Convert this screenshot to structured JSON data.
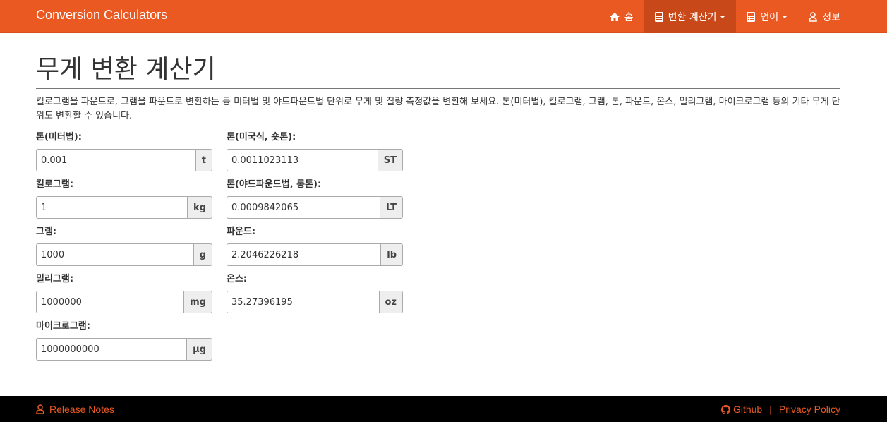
{
  "navbar": {
    "brand": "Conversion Calculators",
    "items": [
      {
        "label": "홈",
        "icon": "home-icon"
      },
      {
        "label": "변환 계산기",
        "icon": "calculator-icon",
        "active": true,
        "dropdown": true
      },
      {
        "label": "언어",
        "icon": "calculator-icon",
        "dropdown": true
      },
      {
        "label": "정보",
        "icon": "user-icon"
      }
    ]
  },
  "page": {
    "title": "무게 변환 계산기",
    "description": "킬로그램을 파운드로, 그램을 파운드로 변환하는 등 미터법 및 야드파운드법 단위로 무게 및 질량 측정값을 변환해 보세요. 톤(미터법), 킬로그램, 그램, 톤, 파운드, 온스, 밀리그램, 마이크로그램 등의 기타 무게 단위도 변환할 수 있습니다."
  },
  "fields": {
    "tonne": {
      "label": "톤(미터법):",
      "value": "0.001",
      "unit": "t"
    },
    "kilogram": {
      "label": "킬로그램:",
      "value": "1",
      "unit": "kg"
    },
    "gram": {
      "label": "그램:",
      "value": "1000",
      "unit": "g"
    },
    "milligram": {
      "label": "밀리그램:",
      "value": "1000000",
      "unit": "mg"
    },
    "microgram": {
      "label": "마이크로그램:",
      "value": "1000000000",
      "unit": "μg"
    },
    "short_ton": {
      "label": "톤(미국식, 숏톤):",
      "value": "0.0011023113",
      "unit": "ST"
    },
    "long_ton": {
      "label": "톤(야드파운드법, 롱톤):",
      "value": "0.0009842065",
      "unit": "LT"
    },
    "pound": {
      "label": "파운드:",
      "value": "2.2046226218",
      "unit": "lb"
    },
    "ounce": {
      "label": "온스:",
      "value": "35.27396195",
      "unit": "oz"
    }
  },
  "footer": {
    "release_notes": "Release Notes",
    "github": "Github",
    "privacy": "Privacy Policy",
    "separator": "|"
  },
  "colors": {
    "accent": "#eb5922",
    "nav_active": "#c9481a",
    "footer_bg": "#000000"
  }
}
